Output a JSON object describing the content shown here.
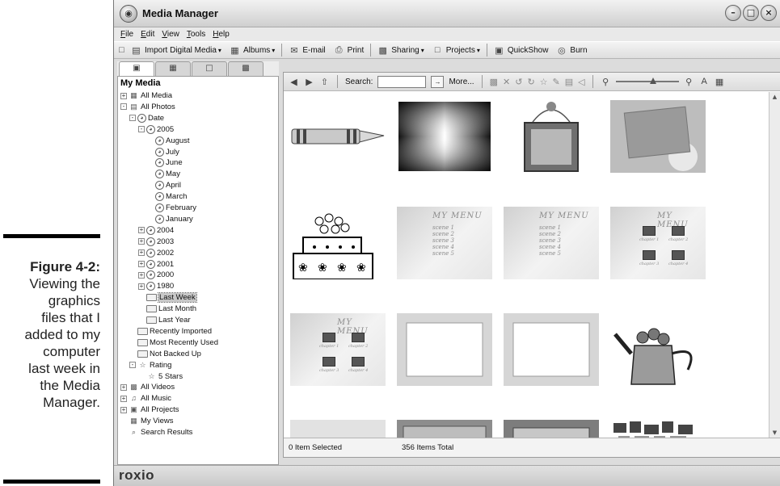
{
  "caption": {
    "figure_label": "Figure 4-2:",
    "lines": [
      "Viewing the",
      "graphics",
      "files that I",
      "added to my",
      "computer",
      "last week in",
      "the Media",
      "Manager."
    ]
  },
  "window": {
    "title": "Media Manager",
    "buttons": [
      "minimize",
      "maximize",
      "close"
    ]
  },
  "menu": [
    "File",
    "Edit",
    "View",
    "Tools",
    "Help"
  ],
  "toolbar": [
    {
      "label": "Import Digital Media",
      "icon": "import-icon",
      "dropdown": true
    },
    {
      "label": "Albums",
      "icon": "album-icon",
      "dropdown": true
    },
    {
      "label": "E-mail",
      "icon": "email-icon",
      "dropdown": false
    },
    {
      "label": "Print",
      "icon": "print-icon",
      "dropdown": false
    },
    {
      "label": "Sharing",
      "icon": "sharing-icon",
      "dropdown": true
    },
    {
      "label": "Projects",
      "icon": "projects-icon",
      "dropdown": true
    },
    {
      "label": "QuickShow",
      "icon": "quickshow-icon",
      "dropdown": false
    },
    {
      "label": "Burn",
      "icon": "burn-icon",
      "dropdown": false
    }
  ],
  "panel": {
    "title": "My Media",
    "tree": [
      {
        "label": "All Media",
        "depth": 0,
        "icon": "media",
        "exp": "+"
      },
      {
        "label": "All Photos",
        "depth": 0,
        "icon": "photos",
        "exp": "-"
      },
      {
        "label": "Date",
        "depth": 1,
        "icon": "clock",
        "exp": "-"
      },
      {
        "label": "2005",
        "depth": 2,
        "icon": "clock",
        "exp": "-"
      },
      {
        "label": "August",
        "depth": 3,
        "icon": "clock",
        "exp": ""
      },
      {
        "label": "July",
        "depth": 3,
        "icon": "clock",
        "exp": ""
      },
      {
        "label": "June",
        "depth": 3,
        "icon": "clock",
        "exp": ""
      },
      {
        "label": "May",
        "depth": 3,
        "icon": "clock",
        "exp": ""
      },
      {
        "label": "April",
        "depth": 3,
        "icon": "clock",
        "exp": ""
      },
      {
        "label": "March",
        "depth": 3,
        "icon": "clock",
        "exp": ""
      },
      {
        "label": "February",
        "depth": 3,
        "icon": "clock",
        "exp": ""
      },
      {
        "label": "January",
        "depth": 3,
        "icon": "clock",
        "exp": ""
      },
      {
        "label": "2004",
        "depth": 2,
        "icon": "clock",
        "exp": "+"
      },
      {
        "label": "2003",
        "depth": 2,
        "icon": "clock",
        "exp": "+"
      },
      {
        "label": "2002",
        "depth": 2,
        "icon": "clock",
        "exp": "+"
      },
      {
        "label": "2001",
        "depth": 2,
        "icon": "clock",
        "exp": "+"
      },
      {
        "label": "2000",
        "depth": 2,
        "icon": "clock",
        "exp": "+"
      },
      {
        "label": "1980",
        "depth": 2,
        "icon": "clock",
        "exp": "+"
      },
      {
        "label": "Last Week",
        "depth": 2,
        "icon": "folder",
        "exp": "",
        "selected": true
      },
      {
        "label": "Last Month",
        "depth": 2,
        "icon": "folder",
        "exp": ""
      },
      {
        "label": "Last Year",
        "depth": 2,
        "icon": "folder",
        "exp": ""
      },
      {
        "label": "Recently Imported",
        "depth": 1,
        "icon": "folder",
        "exp": ""
      },
      {
        "label": "Most Recently Used",
        "depth": 1,
        "icon": "folder",
        "exp": ""
      },
      {
        "label": "Not Backed Up",
        "depth": 1,
        "icon": "folder",
        "exp": ""
      },
      {
        "label": "Rating",
        "depth": 1,
        "icon": "star",
        "exp": "-"
      },
      {
        "label": "5 Stars",
        "depth": 2,
        "icon": "star",
        "exp": ""
      },
      {
        "label": "All Videos",
        "depth": 0,
        "icon": "video",
        "exp": "+"
      },
      {
        "label": "All Music",
        "depth": 0,
        "icon": "music",
        "exp": "+"
      },
      {
        "label": "All Projects",
        "depth": 0,
        "icon": "projects",
        "exp": "+"
      },
      {
        "label": "My Views",
        "depth": 0,
        "icon": "views",
        "exp": ""
      },
      {
        "label": "Search Results",
        "depth": 0,
        "icon": "search",
        "exp": ""
      }
    ]
  },
  "content": {
    "search_label": "Search:",
    "search_value": "",
    "more_label": "More...",
    "zoom_fraction": 0.6,
    "thumbnails": [
      {
        "name": "crayon",
        "type": "crayon"
      },
      {
        "name": "gradient-burst",
        "type": "gradient"
      },
      {
        "name": "hanging-frame",
        "type": "frame-hang"
      },
      {
        "name": "daisy-photo-frame",
        "type": "daisy-frame"
      },
      {
        "name": "cake",
        "type": "cake"
      },
      {
        "name": "menu-template-1",
        "type": "menu-list"
      },
      {
        "name": "menu-template-2",
        "type": "menu-list"
      },
      {
        "name": "menu-template-3",
        "type": "menu-thumbs"
      },
      {
        "name": "menu-template-4",
        "type": "menu-thumbs"
      },
      {
        "name": "blank-frame-1",
        "type": "blank-frame"
      },
      {
        "name": "blank-frame-2",
        "type": "blank-frame"
      },
      {
        "name": "watering-can",
        "type": "watering-can"
      },
      {
        "name": "cd-disc",
        "type": "partial-disc"
      },
      {
        "name": "orange-frame",
        "type": "partial-frame"
      },
      {
        "name": "photo-frame",
        "type": "partial-frame2"
      },
      {
        "name": "mosaic",
        "type": "partial-mosaic"
      }
    ],
    "menu_text": {
      "heading": "MY MENU",
      "items": [
        "scene 1",
        "scene 2",
        "scene 3",
        "scene 4",
        "scene 5"
      ],
      "chapters": [
        "chapter 1",
        "chapter 2",
        "chapter 3",
        "chapter 4"
      ]
    },
    "status": {
      "selected": "0 Item Selected",
      "total": "356 Items Total"
    }
  },
  "brand": "roxio"
}
